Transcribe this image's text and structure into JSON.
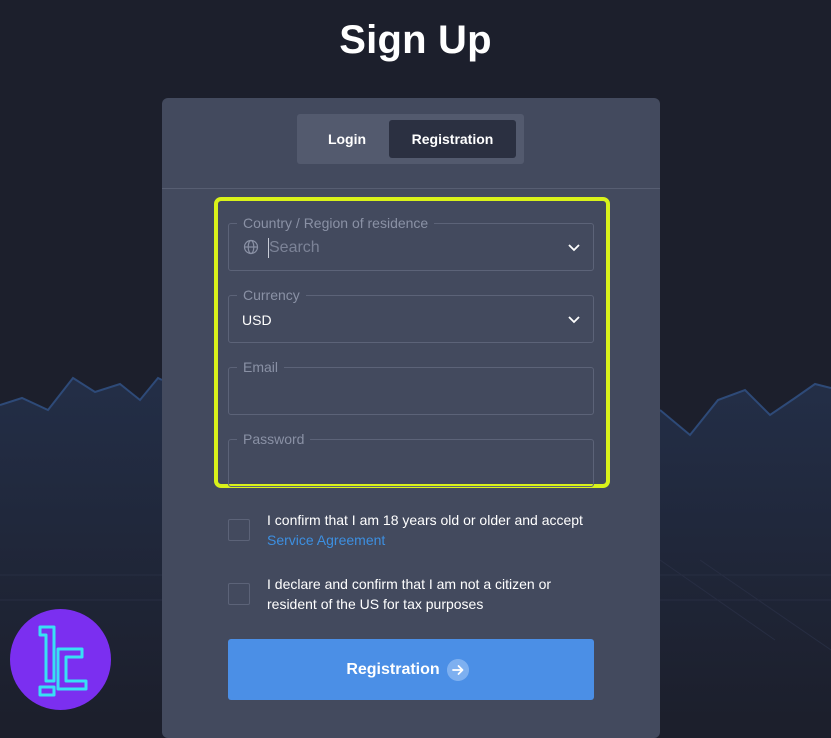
{
  "page": {
    "title": "Sign Up"
  },
  "tabs": {
    "login": "Login",
    "registration": "Registration"
  },
  "form": {
    "country": {
      "legend": "Country / Region of residence",
      "placeholder": "Search",
      "icon": "globe-icon"
    },
    "currency": {
      "legend": "Currency",
      "value": "USD"
    },
    "email": {
      "legend": "Email",
      "value": ""
    },
    "password": {
      "legend": "Password",
      "value": ""
    }
  },
  "consents": {
    "age": {
      "text": "I confirm that I am 18 years old or older and accept",
      "link": "Service Agreement",
      "checked": false
    },
    "us": {
      "text": "I declare and confirm that I am not a citizen or resident of the US for tax purposes",
      "checked": false
    }
  },
  "submit": {
    "label": "Registration",
    "icon": "arrow-right-icon"
  },
  "colors": {
    "background": "#1c1f2c",
    "card": "#434a5e",
    "accent": "#4b8fe6",
    "highlight": "#d9f21a",
    "link": "#3d8fe0"
  }
}
